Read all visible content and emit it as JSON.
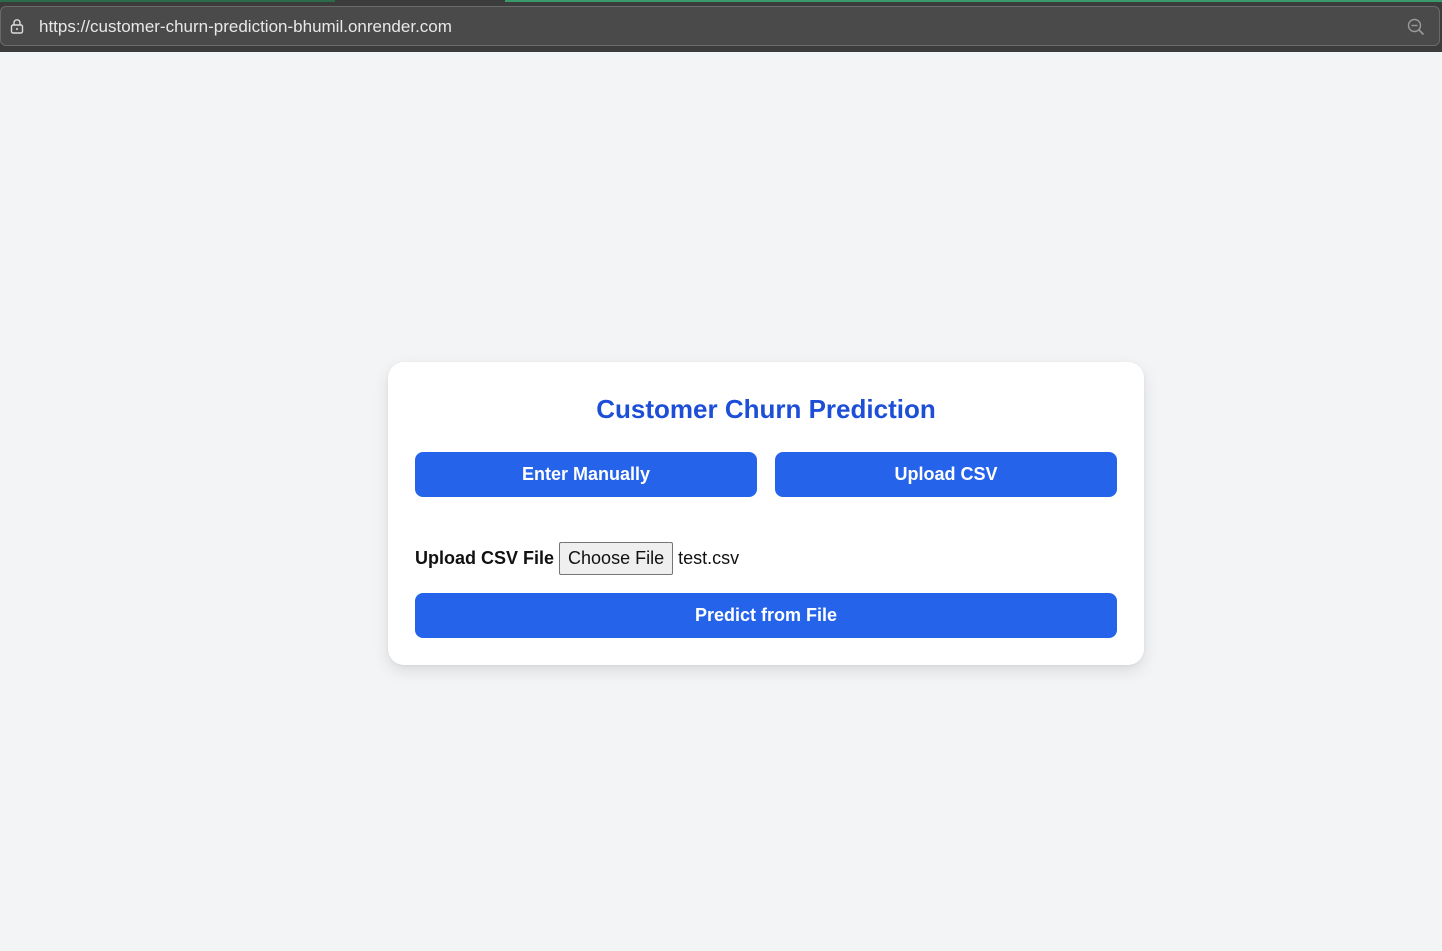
{
  "browser": {
    "url": "https://customer-churn-prediction-bhumil.onrender.com",
    "icons": {
      "lock": "lock-icon",
      "zoom": "zoom-out-icon"
    }
  },
  "card": {
    "title": "Customer Churn Prediction",
    "mode_buttons": {
      "manual_label": "Enter Manually",
      "upload_label": "Upload CSV"
    },
    "upload": {
      "label": "Upload CSV File",
      "choose_button": "Choose File",
      "file_name": "test.csv"
    },
    "predict_label": "Predict from File"
  },
  "colors": {
    "page_background": "#f3f4f6",
    "title": "#1d4ed8",
    "button": "#2563eb",
    "button_text": "#ffffff"
  }
}
